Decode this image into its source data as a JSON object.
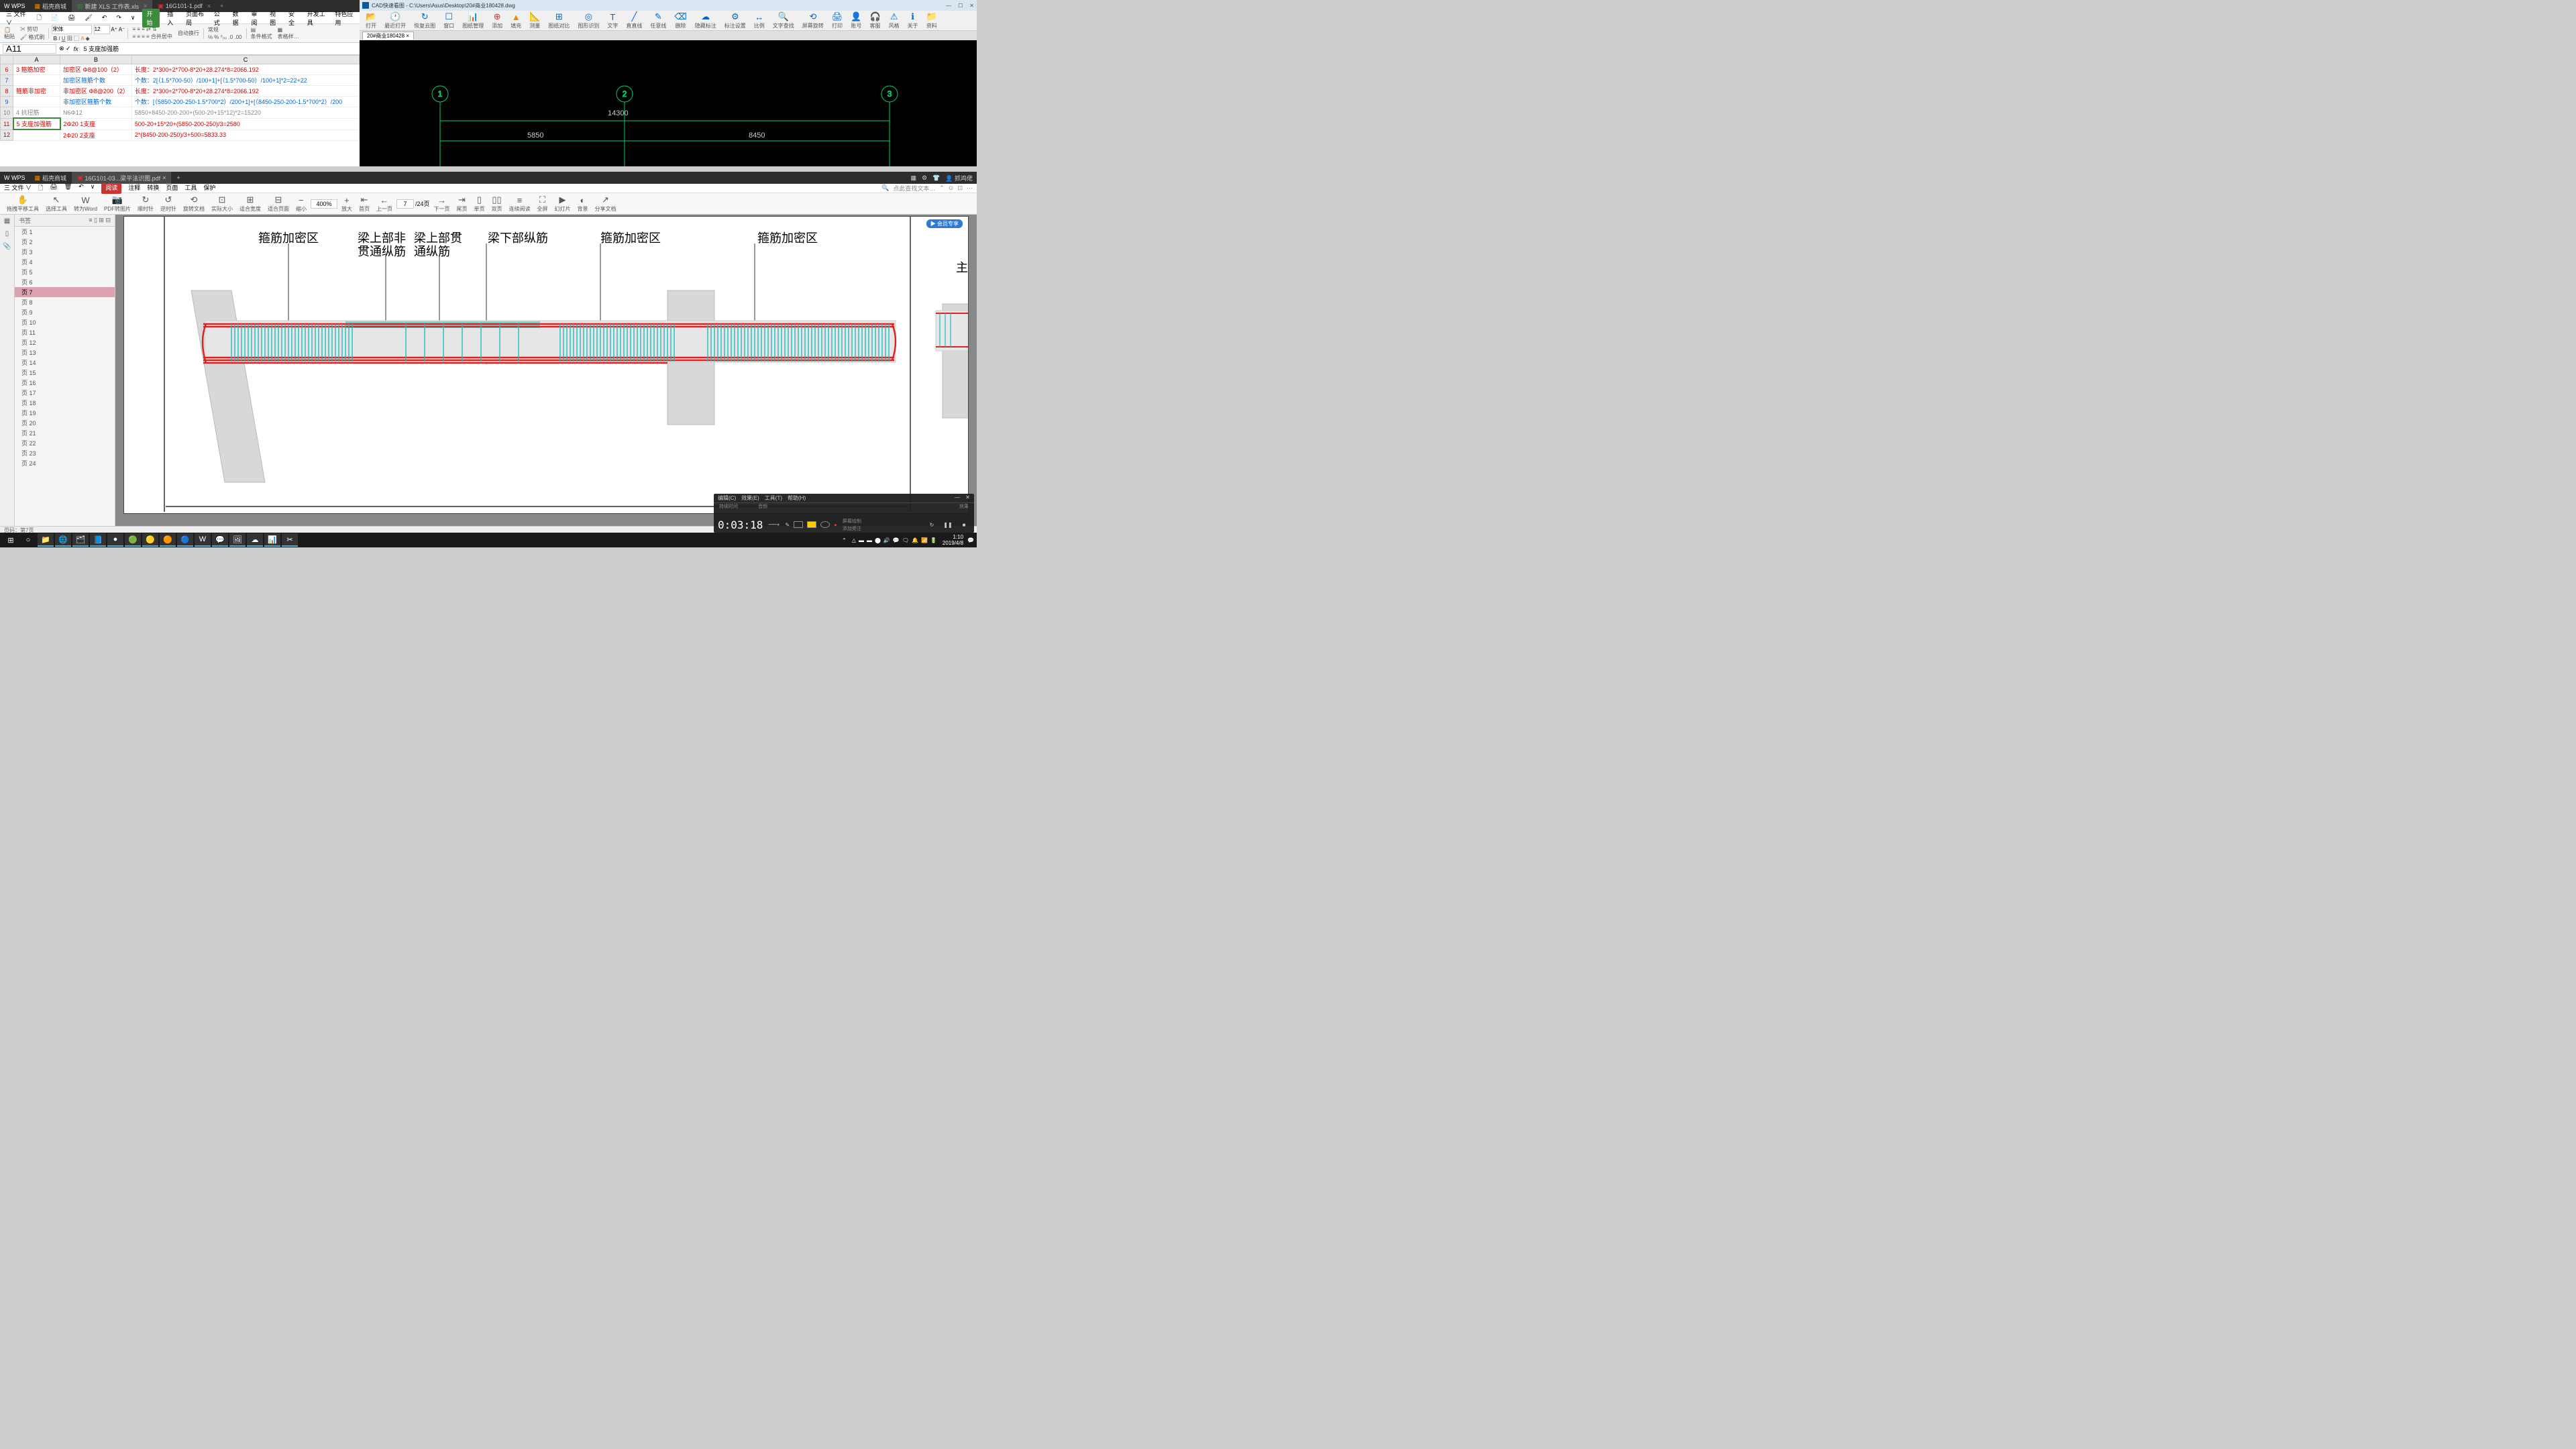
{
  "wps": {
    "logo": "W WPS",
    "tabs": [
      {
        "icon": "▦",
        "label": "稻壳商城"
      },
      {
        "icon": "▤",
        "label": "新建 XLS 工作表.xls",
        "active": true
      },
      {
        "icon": "▣",
        "label": "16G101-1.pdf"
      }
    ],
    "menubar": [
      "三 文件 ∨",
      "🗋",
      "📄",
      "🖨",
      "🖌",
      "↶",
      "↷",
      "∨"
    ],
    "ribbon_tabs": [
      "开始",
      "插入",
      "页面布局",
      "公式",
      "数据",
      "审阅",
      "视图",
      "安全",
      "开发工具",
      "特色应用"
    ],
    "ribbon_active": "开始",
    "toolbar": {
      "paste": "粘贴",
      "cut": "剪切",
      "format": "格式刷",
      "font": "宋体",
      "size": "12",
      "merge": "合并居中",
      "wrap": "自动换行",
      "general": "常规",
      "cond_fmt": "条件格式",
      "table_style": "表格样…"
    },
    "formula": {
      "cell": "A11",
      "fx": "fx",
      "value": "5 支座加强筋"
    },
    "columns": [
      "",
      "A",
      "B",
      "C"
    ],
    "rows": [
      {
        "n": "6",
        "a": "3  箍筋加密",
        "b": "加密区     Φ8@100（2）",
        "c": "长度：2*300+2*700-8*20+28.274*8=2066.192",
        "cls": "red"
      },
      {
        "n": "7",
        "a": "",
        "b": "加密区箍筋个数",
        "c": "个数：2[（1.5*700-50）/100+1]+[（1.5*700-50）/100+1]*2=22+22",
        "cls": "blue"
      },
      {
        "n": "8",
        "a": "   箍筋非加密",
        "b": "非加密区   Φ8@200（2）",
        "c": "长度：2*300+2*700-8*20+28.274*8=2066.192",
        "cls": "red"
      },
      {
        "n": "9",
        "a": "",
        "b": "非加密区箍筋个数",
        "c": "个数：[（5850-200-250-1.5*700*2）/200+1]+[（8450-250-200-1.5*700*2）/200",
        "cls": "blue"
      },
      {
        "n": "10",
        "a": "4 抗扭筋",
        "b": "N6Φ12",
        "c": "5850+8450-200-200+(500-20+15*12)*2=15220",
        "cls": "gray"
      },
      {
        "n": "11",
        "a": "5 支座加强筋",
        "b": "2Φ20          1支座",
        "c": "500-20+15*20+(5850-200-250)/3=2580",
        "cls": "red"
      },
      {
        "n": "12",
        "a": "",
        "b": "2Φ20          2支座",
        "c": "2*(8450-200-250)/3+500=5833.33",
        "cls": "red"
      }
    ]
  },
  "cad": {
    "title": "CAD快速看图 - C:\\Users\\Asus\\Desktop\\20#商业180428.dwg",
    "toolbar": [
      {
        "icon": "📂",
        "label": "打开"
      },
      {
        "icon": "🕐",
        "label": "最近打开"
      },
      {
        "icon": "↻",
        "label": "恢复云图"
      },
      {
        "icon": "☐",
        "label": "窗口"
      },
      {
        "icon": "📊",
        "label": "图纸管理"
      },
      {
        "icon": "⊕",
        "label": "添加",
        "red": true
      },
      {
        "icon": "▲",
        "label": "填充",
        "orange": true
      },
      {
        "icon": "📐",
        "label": "测量"
      },
      {
        "icon": "⊞",
        "label": "图纸对比"
      },
      {
        "icon": "◎",
        "label": "图形识别"
      },
      {
        "icon": "T",
        "label": "文字"
      },
      {
        "icon": "╱",
        "label": "直直线"
      },
      {
        "icon": "✎",
        "label": "任意线"
      },
      {
        "icon": "⌫",
        "label": "删除"
      },
      {
        "icon": "☁",
        "label": "隐藏标注"
      },
      {
        "icon": "⚙",
        "label": "标注设置"
      },
      {
        "icon": "↔",
        "label": "比例"
      },
      {
        "icon": "🔍",
        "label": "文字查找"
      },
      {
        "icon": "⟲",
        "label": "屏幕旋转"
      },
      {
        "icon": "🖨",
        "label": "打印"
      },
      {
        "icon": "👤",
        "label": "账号"
      },
      {
        "icon": "🎧",
        "label": "客服"
      },
      {
        "icon": "⚠",
        "label": "风格"
      },
      {
        "icon": "ℹ",
        "label": "关于"
      },
      {
        "icon": "📁",
        "label": "资料"
      }
    ],
    "tab": "20#商业180428  ×",
    "dims": {
      "top": "14300",
      "left": "5850",
      "right": "8450"
    },
    "nodes": [
      "1",
      "2",
      "3"
    ]
  },
  "pdf": {
    "logo": "W WPS",
    "tabs": [
      {
        "icon": "▦",
        "label": "稻壳商城"
      },
      {
        "icon": "▣",
        "label": "16G101-03...梁平法识图.pdf",
        "active": true
      }
    ],
    "user": "抓鸡佬",
    "menubar": [
      "三 文件 ∨",
      "🗋",
      "🖨",
      "🗑",
      "↶",
      "∨"
    ],
    "ribbon": [
      "阅读",
      "注释",
      "转换",
      "页面",
      "工具",
      "保护"
    ],
    "ribbon_active": "阅读",
    "search_placeholder": "点此查找文本…",
    "toolbar": [
      {
        "ico": "✋",
        "label": "拖拽平移工具"
      },
      {
        "ico": "↖",
        "label": "选择工具"
      },
      {
        "ico": "W",
        "label": "转为Word"
      },
      {
        "ico": "📷",
        "label": "PDF转图片"
      },
      {
        "ico": "↻",
        "label": "顺时针"
      },
      {
        "ico": "↺",
        "label": "逆时针"
      },
      {
        "ico": "⟲",
        "label": "旋转文档"
      },
      {
        "ico": "⊡",
        "label": "实际大小"
      },
      {
        "ico": "⊞",
        "label": "适合宽度"
      },
      {
        "ico": "⊟",
        "label": "适合页面"
      },
      {
        "ico": "−",
        "label": "缩小"
      }
    ],
    "zoom": "400%",
    "toolbar2": [
      {
        "ico": "+",
        "label": "放大"
      },
      {
        "ico": "⇤",
        "label": "首页"
      },
      {
        "ico": "←",
        "label": "上一页"
      }
    ],
    "page_current": "7",
    "page_total": "/24页",
    "toolbar3": [
      {
        "ico": "→",
        "label": "下一页"
      },
      {
        "ico": "⇥",
        "label": "尾页"
      },
      {
        "ico": "▯",
        "label": "单页"
      },
      {
        "ico": "▯▯",
        "label": "双页"
      },
      {
        "ico": "≡",
        "label": "连续阅读"
      },
      {
        "ico": "⛶",
        "label": "全屏"
      },
      {
        "ico": "▶",
        "label": "幻灯片"
      },
      {
        "ico": "◐",
        "label": "背景"
      },
      {
        "ico": "↗",
        "label": "分享文档"
      }
    ],
    "bookmarks_header": "书签",
    "bookmarks": [
      "页 1",
      "页 2",
      "页 3",
      "页 4",
      "页 5",
      "页 6",
      "页 7",
      "页 8",
      "页 9",
      "页 10",
      "页 11",
      "页 12",
      "页 13",
      "页 14",
      "页 15",
      "页 16",
      "页 17",
      "页 18",
      "页 19",
      "页 20",
      "页 21",
      "页 22",
      "页 23",
      "页 24"
    ],
    "bookmark_active": 6,
    "labels": {
      "l1": "箍筋加密区",
      "l2a": "梁上部非",
      "l2b": "贯通纵筋",
      "l3a": "梁上部贯",
      "l3b": "通纵筋",
      "l4": "梁下部纵筋",
      "l5": "箍筋加密区",
      "l6": "箍筋加密区",
      "l7": "主"
    },
    "badge": "▶ 会员专享",
    "status": "页码：第7页"
  },
  "recorder": {
    "menus": [
      "编辑(C)",
      "效果(E)",
      "工具(T)",
      "帮助(H)"
    ],
    "headers": [
      "持续时间",
      "音频",
      "效果"
    ],
    "time": "0:03:18",
    "sliders": [
      "屏幕绘制",
      "",
      "添加旁注"
    ]
  },
  "taskbar": {
    "apps": [
      "⊞",
      "○",
      "📁",
      "🌐",
      "🗂",
      "📘",
      "●",
      "🟢",
      "🟡",
      "🟠",
      "🔵",
      "W",
      "💬",
      "🖼",
      "☁",
      "📊",
      "✂"
    ],
    "tray": [
      "△",
      "▬",
      "▬",
      "⬤",
      "🔊",
      "💬",
      "🗨",
      "🔔",
      "📶",
      "🔋"
    ],
    "time": "1:10",
    "date": "2019/4/8"
  }
}
